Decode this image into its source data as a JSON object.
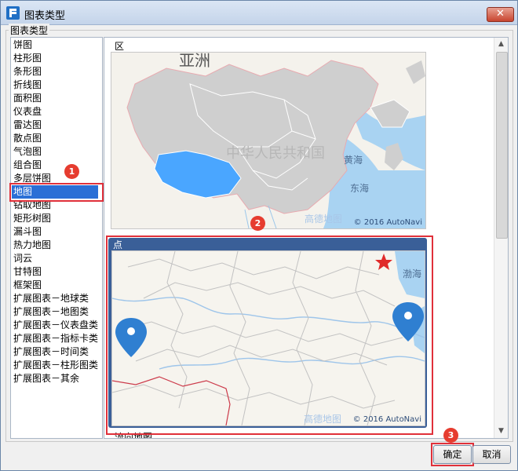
{
  "window": {
    "title": "图表类型",
    "close_label": "✕"
  },
  "group_legend": "图表类型",
  "chart_types": [
    "饼图",
    "柱形图",
    "条形图",
    "折线图",
    "面积图",
    "仪表盘",
    "雷达图",
    "散点图",
    "气泡图",
    "组合图",
    "多层饼图",
    "地图",
    "钻取地图",
    "矩形树图",
    "漏斗图",
    "热力地图",
    "词云",
    "甘特图",
    "框架图",
    "扩展图表－地球类",
    "扩展图表－地图类",
    "扩展图表－仪表盘类",
    "扩展图表－指标卡类",
    "扩展图表－时间类",
    "扩展图表－柱形图类",
    "扩展图表－其余"
  ],
  "selected_type": "地图",
  "preview": {
    "region_map": {
      "title": "区域地图",
      "labels": {
        "continent": "亚洲",
        "country": "中华人民共和国",
        "sea1": "黄海",
        "sea2": "东海"
      },
      "logo": "高德地图",
      "attribution": "© 2016 AutoNavi"
    },
    "point_map": {
      "title": "点地图",
      "labels": {
        "sea": "渤海"
      },
      "logo": "高德地图",
      "attribution": "© 2016 AutoNavi"
    },
    "next_title": "流向地图"
  },
  "badges": [
    "1",
    "2",
    "3"
  ],
  "buttons": {
    "ok": "确定",
    "cancel": "取消"
  },
  "colors": {
    "accent": "#2a6fd6",
    "annotation": "#e0303a",
    "highlight_region": "#4aa6ff",
    "marker": "#2f7fd1"
  },
  "icons": {
    "close": "close-icon",
    "app": "app-logo-icon",
    "pin": "map-pin-icon",
    "star": "star-icon"
  }
}
